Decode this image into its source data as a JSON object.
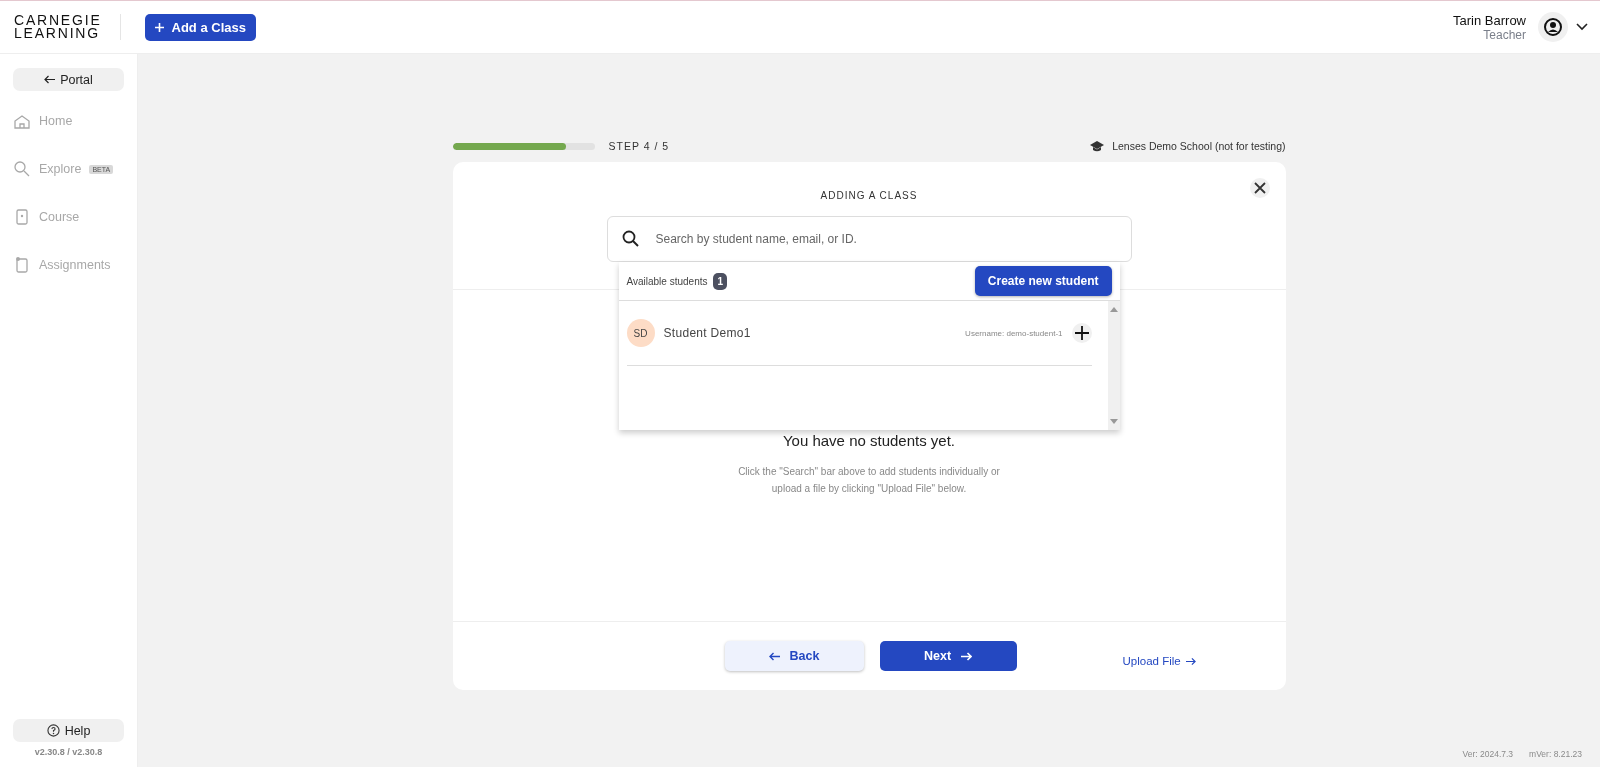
{
  "header": {
    "logo": [
      "CARNEGIE",
      "LEARNING"
    ],
    "add_button": "Add a Class",
    "user": {
      "name": "Tarin Barrow",
      "role": "Teacher"
    }
  },
  "sidebar": {
    "portal": "Portal",
    "items": [
      {
        "label": "Home",
        "kind": "home",
        "disabled": true
      },
      {
        "label": "Explore",
        "kind": "search",
        "badge": "BETA",
        "disabled": true
      },
      {
        "label": "Course",
        "kind": "course",
        "disabled": true
      },
      {
        "label": "Assignments",
        "kind": "assignments",
        "disabled": true
      }
    ],
    "help": "Help",
    "version": "v2.30.8 / v2.30.8"
  },
  "progress": {
    "level": 0.8,
    "step": "STEP 4 / 5",
    "school": "Lenses Demo School (not for testing)"
  },
  "card": {
    "title": "ADDING A CLASS",
    "search": {
      "placeholder": "Search by student name, email, or ID."
    },
    "dropdown": {
      "label": "Available students",
      "count": "1",
      "create_button": "Create new student",
      "students": [
        {
          "initials": "SD",
          "name": "Student Demo1",
          "username": "Username: demo-student-1"
        }
      ]
    },
    "empty_title": "You have no students yet.",
    "empty_text": "Click the \"Search\" bar above to add students individually or upload a file by clicking \"Upload File\" below.",
    "back": "Back",
    "next": "Next",
    "upload": "Upload File"
  },
  "footer": {
    "ver": "Ver: 2024.7.3",
    "mver": "mVer: 8.21.23"
  }
}
